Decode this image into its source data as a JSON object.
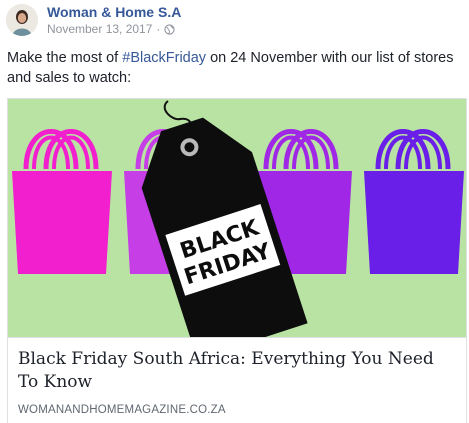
{
  "post": {
    "author": "Woman & Home S.A",
    "date": "November 13, 2017",
    "separator": "·",
    "privacy_icon": "globe-icon",
    "text_before": "Make the most of ",
    "hashtag": "#BlackFriday",
    "text_after": " on 24 November with our list of stores and sales to watch:"
  },
  "link_card": {
    "image_tag_line1": "BLACK",
    "image_tag_line2": "FRIDAY",
    "title": "Black Friday South Africa: Everything You Need To Know",
    "domain": "WOMANANDHOMEMAGAZINE.CO.ZA"
  },
  "colors": {
    "background_green": "#b9e3a2",
    "bag_pink": "#f21fcf",
    "bag_violet": "#c63ee6",
    "bag_purple": "#a027e6",
    "bag_indigo": "#6a1fe8",
    "tag_black": "#0d0d0d",
    "link_blue": "#365899"
  }
}
